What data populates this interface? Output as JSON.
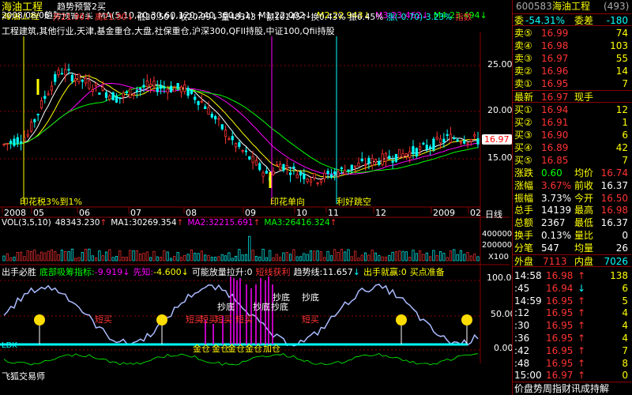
{
  "main": {
    "stock_name": "海油工程",
    "indicator": "趋势预警2买",
    "ma_label": "MA(5,10,20,30,60,120,240,360,4,1)",
    "ma_values": [
      {
        "label": "M1:22.002",
        "arrow": "↓",
        "color": "#ffffff"
      },
      {
        "label": "M2:22.943",
        "arrow": "↓",
        "color": "#ffff00"
      },
      {
        "label": "M3:23.462",
        "arrow": "↓",
        "color": "#ff00ff"
      },
      {
        "label": "M4:23.494",
        "arrow": "↓",
        "color": "#00ff00"
      }
    ],
    "info_row": {
      "date": "2008/08/06",
      "open": "开21.90",
      "open_arrow": "↓",
      "high": "高21.90",
      "high_arrow": "↓",
      "low": "低20.50",
      "low_arrow": "↓",
      "close": "收20.99",
      "close_arrow": "↓",
      "volume": "量48343",
      "vol_arrow": "↑",
      "amount": "额10145",
      "amount_arrow": "↑",
      "turnover": "换0.43%",
      "amplitude": "振6.45%",
      "change": "涨(-0.70)-3.23%",
      "tag": "指数"
    },
    "concepts": "工程建筑,其他行业,天津,基金重仓,大盘,社保重仓,沪深300,QFII持股,中证100,Qfii持股",
    "price_ticks": [
      "25.00",
      "20.00",
      "15.00"
    ],
    "current_price": "16.97",
    "annotations": [
      {
        "text": "印花税3%到1%"
      },
      {
        "text": "印花单向"
      },
      {
        "text": "利好跳空"
      }
    ],
    "x_axis": [
      "2008",
      "05",
      "06",
      "07",
      "08",
      "09",
      "10",
      "11",
      "12",
      "2009",
      "02"
    ],
    "period": "日线"
  },
  "volume": {
    "label": "VOL(3,5,10)",
    "value": "48343.230",
    "value_arrow": "↑",
    "ma1": "MA1:30269.354",
    "ma1_arrow": "↑",
    "ma2": "MA2:32215.691",
    "ma2_arrow": "↑",
    "ma3": "MA3:26416.324",
    "ma3_arrow": "↑",
    "ticks": [
      "400000",
      "200000",
      "X100"
    ]
  },
  "indicator": {
    "title": "出手必胜",
    "items": [
      {
        "label": "底部吸筹指标:",
        "value": "-9.919",
        "arrow": "↓",
        "color": "#ff00ff"
      },
      {
        "label": "先知:",
        "value": "-4.600",
        "arrow": "↓",
        "color": "#ffff00"
      },
      {
        "label": "可能放量拉升:",
        "value": "0",
        "color": "#ffffff"
      },
      {
        "label": "短线获利",
        "value": "",
        "color": "#ff3333"
      },
      {
        "label": "趋势线:",
        "value": "11.657",
        "arrow": "↓",
        "color": "#ffffff"
      },
      {
        "label": "出手就赢:",
        "value": "0",
        "color": "#ffff00"
      },
      {
        "label": "买点准备",
        "value": "",
        "color": "#ff3333"
      }
    ],
    "ticks": [
      "100.00",
      "50.00",
      "0.00"
    ],
    "marks": [
      {
        "text": "短买"
      },
      {
        "text": "短买"
      },
      {
        "text": "短买"
      },
      {
        "text": "短买"
      },
      {
        "text": "短买"
      },
      {
        "text": "短买"
      },
      {
        "text": "抄底"
      },
      {
        "text": "抄底"
      },
      {
        "text": "抄底"
      },
      {
        "text": "抄底"
      },
      {
        "text": "抄底"
      },
      {
        "text": "金仓"
      },
      {
        "text": "金仓"
      },
      {
        "text": "金仓"
      },
      {
        "text": "金仓"
      },
      {
        "text": "加仓"
      }
    ],
    "footer": "飞狐交易师",
    "left_bottom": "LDK"
  },
  "right_panel": {
    "code": "600583",
    "name": "海油工程",
    "num": "(493)",
    "ratio_label": "委",
    "ratio_value": "-54.31%",
    "diff_label": "委差",
    "diff_value": "-180",
    "sells": [
      {
        "label": "卖⑤",
        "price": "16.99",
        "vol": "74"
      },
      {
        "label": "卖④",
        "price": "16.98",
        "vol": "103"
      },
      {
        "label": "卖③",
        "price": "16.97",
        "vol": "55"
      },
      {
        "label": "卖②",
        "price": "16.96",
        "vol": "14"
      },
      {
        "label": "卖①",
        "price": "16.95",
        "vol": "7"
      }
    ],
    "last_label": "最新",
    "last_price": "16.97",
    "last_tag": "现手",
    "buys": [
      {
        "label": "买①",
        "price": "16.94",
        "vol": "12"
      },
      {
        "label": "买②",
        "price": "16.91",
        "vol": "1"
      },
      {
        "label": "买③",
        "price": "16.90",
        "vol": "6"
      },
      {
        "label": "买④",
        "price": "16.89",
        "vol": "42"
      },
      {
        "label": "买⑤",
        "price": "16.85",
        "vol": "7"
      }
    ],
    "stats": [
      {
        "l1": "涨跌",
        "v1": "0.60",
        "l2": "均价",
        "v2": "16.74"
      },
      {
        "l1": "涨幅",
        "v1": "3.67%",
        "l2": "前收",
        "v2": "16.37"
      },
      {
        "l1": "振幅",
        "v1": "3.73%",
        "l2": "今开",
        "v2": "16.50"
      },
      {
        "l1": "总手",
        "v1": "14139",
        "l2": "最高",
        "v2": "16.98"
      },
      {
        "l1": "总额",
        "v1": "2367",
        "l2": "最低",
        "v2": "16.37"
      },
      {
        "l1": "换手",
        "v1": "0.13%",
        "l2": "量比",
        "v2": "0"
      },
      {
        "l1": "分笔",
        "v1": "547",
        "l2": "均量",
        "v2": "26"
      }
    ],
    "outer_label": "外盘",
    "outer_value": "7113",
    "inner_label": "内盘",
    "inner_value": "7026",
    "ticks": [
      {
        "time": "14:58",
        "price": "16.98",
        "arrow": "↑",
        "vol": "138"
      },
      {
        "time": ":45",
        "price": "16.94",
        "arrow": "↓",
        "vol": "6"
      },
      {
        "time": "14:59",
        "price": "16.95",
        "arrow": "↑",
        "vol": "5"
      },
      {
        "time": ":12",
        "price": "16.95",
        "arrow": "↑",
        "vol": "4"
      },
      {
        "time": ":30",
        "price": "16.95",
        "arrow": "↑",
        "vol": "4"
      },
      {
        "time": ":36",
        "price": "16.95",
        "arrow": "↑",
        "vol": "4"
      },
      {
        "time": ":42",
        "price": "16.95",
        "arrow": "↑",
        "vol": "7"
      },
      {
        "time": ":48",
        "price": "16.95",
        "arrow": "↑",
        "vol": "8"
      },
      {
        "time": "15:00",
        "price": "16.97",
        "arrow": "↑",
        "vol": "0"
      }
    ],
    "footer": "价盘势周指财讯成持解"
  },
  "colors": {
    "up": "#ff3333",
    "down": "#00ffff",
    "bg": "#000000",
    "grid": "#8b0000"
  }
}
